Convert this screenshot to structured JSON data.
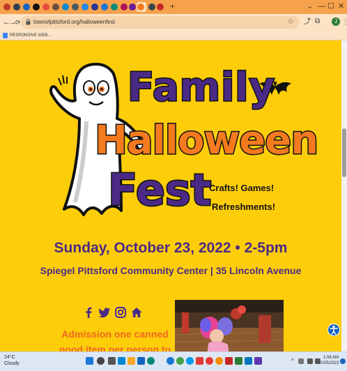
{
  "browser": {
    "url": "townofpittsford.org/halloweenfest",
    "new_tab": "+",
    "window_controls": [
      "⌄",
      "—",
      "☐",
      "✕"
    ],
    "nav": {
      "back": "←",
      "forward": "→",
      "reload": "⟳"
    },
    "toolbar_icons": [
      "⤴",
      "☆",
      "⧉",
      "⋮"
    ],
    "avatar_letter": "J"
  },
  "bookmarks": [
    {
      "label": "RESPONSIVE WEB..."
    }
  ],
  "event": {
    "title_word1": "Family",
    "title_word2": "Halloween",
    "title_word3": "Fest",
    "tagline1": "Crafts!  Games!",
    "tagline2": "Refreshments!",
    "date": "Sunday, October 23, 2022 • 2-5pm",
    "location": "Spiegel Pittsford Community Center | 35 Lincoln Avenue",
    "admission": "Admission one canned good item per person to benefit"
  },
  "social_icons": [
    "facebook-icon",
    "twitter-icon",
    "instagram-icon",
    "home-icon"
  ],
  "taskbar": {
    "weather_temp": "24°C",
    "weather_desc": "Cloudy",
    "time": "1:08 AM",
    "date": "10/5/2022"
  },
  "colors": {
    "page_bg": "#FDCD0A",
    "purple": "#4B2A86",
    "orange": "#F47A1F",
    "tab_strip": "#F6A24C"
  }
}
